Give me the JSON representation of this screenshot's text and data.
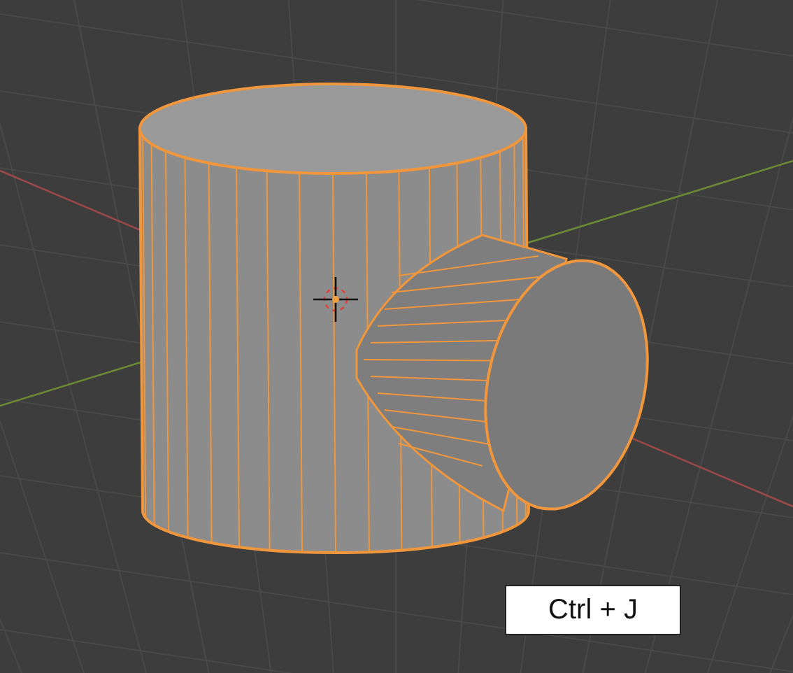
{
  "shortcut_label": {
    "text": "Ctrl + J"
  }
}
